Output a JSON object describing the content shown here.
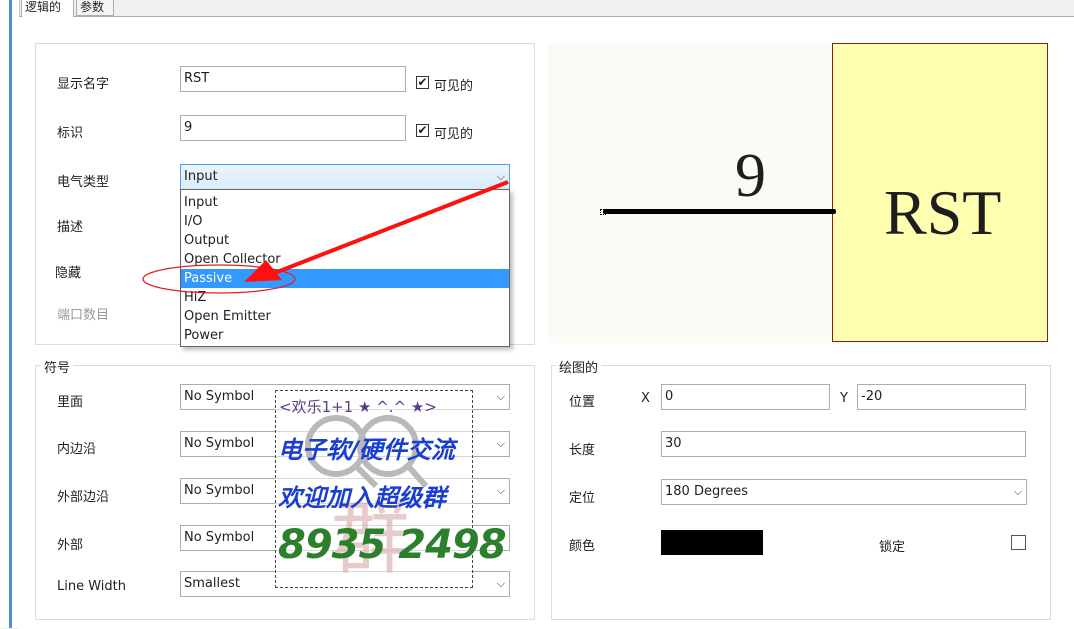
{
  "tabs": [
    {
      "label": "逻辑的",
      "active": true
    },
    {
      "label": "参数",
      "active": false
    }
  ],
  "properties": {
    "display_name": {
      "label": "显示名字",
      "value": "RST",
      "visible_label": "可见的",
      "visible": true
    },
    "designator": {
      "label": "标识",
      "value": "9",
      "visible_label": "可见的",
      "visible": true
    },
    "electrical_type": {
      "label": "电气类型",
      "value": "Input"
    },
    "description": {
      "label": "描述"
    },
    "hide": {
      "label": "隐藏"
    },
    "port_count": {
      "label": "端口数目"
    }
  },
  "dropdown": {
    "options": [
      "Input",
      "I/O",
      "Output",
      "Open Collector",
      "Passive",
      "HiZ",
      "Open Emitter",
      "Power"
    ],
    "highlighted": "Passive"
  },
  "symbols": {
    "group_label": "符号",
    "inside": {
      "label": "里面",
      "value": "No Symbol"
    },
    "inside_edge": {
      "label": "内边沿",
      "value": "No Symbol"
    },
    "outside_edge": {
      "label": "外部边沿",
      "value": "No Symbol"
    },
    "outside": {
      "label": "外部",
      "value": "No Symbol"
    },
    "line_width": {
      "label": "Line Width",
      "value": "Smallest"
    }
  },
  "graphics": {
    "group_label": "绘图的",
    "location": {
      "label": "位置",
      "x_label": "X",
      "x": "0",
      "y_label": "Y",
      "y": "-20"
    },
    "length": {
      "label": "长度",
      "value": "30"
    },
    "orientation": {
      "label": "定位",
      "value": "180 Degrees"
    },
    "color": {
      "label": "颜色",
      "value": "#000000"
    },
    "locked": {
      "label": "锁定",
      "checked": false
    }
  },
  "preview": {
    "pin_number": "9",
    "pin_name": "RST",
    "body_color": "#ffffb0",
    "border_color": "#8b1a1a"
  },
  "watermark": {
    "top": "<欢乐1+1 ★ ^.^ ★>",
    "line1": "电子软/硬件交流",
    "line2": "欢迎加入超级群",
    "number": "8935 2498"
  }
}
